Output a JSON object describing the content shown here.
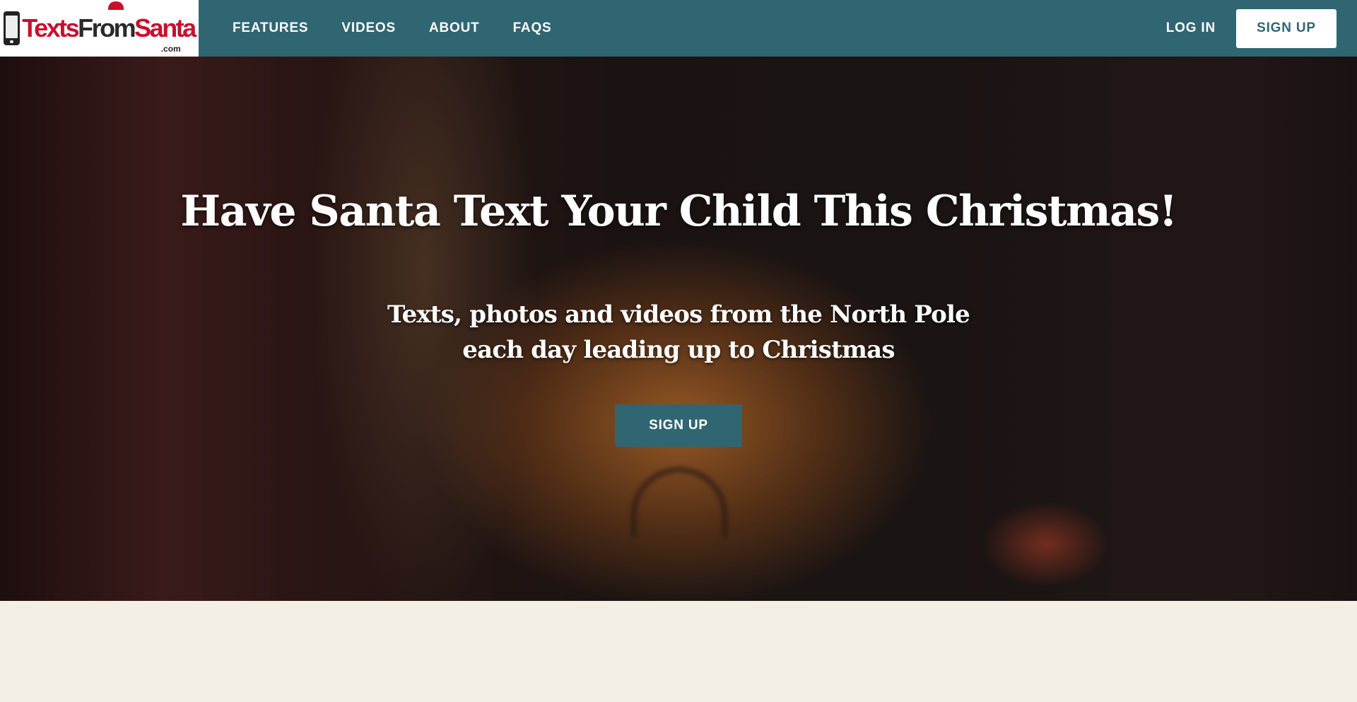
{
  "header": {
    "logo": {
      "text_part1": "Texts",
      "text_part2": "From",
      "text_part3": "Santa",
      "suffix": ".com",
      "icon": "phone-icon"
    },
    "nav": [
      {
        "label": "FEATURES"
      },
      {
        "label": "VIDEOS"
      },
      {
        "label": "ABOUT"
      },
      {
        "label": "FAQS"
      }
    ],
    "login_label": "LOG IN",
    "signup_label": "SIGN UP"
  },
  "hero": {
    "title": "Have Santa Text Your Child This Christmas!",
    "subtitle_line1": "Texts, photos and videos from the North Pole",
    "subtitle_line2": "each day leading up to Christmas",
    "cta_label": "SIGN UP"
  },
  "colors": {
    "brand_teal": "#306672",
    "logo_red": "#c8102e",
    "page_background": "#f3efe5"
  }
}
